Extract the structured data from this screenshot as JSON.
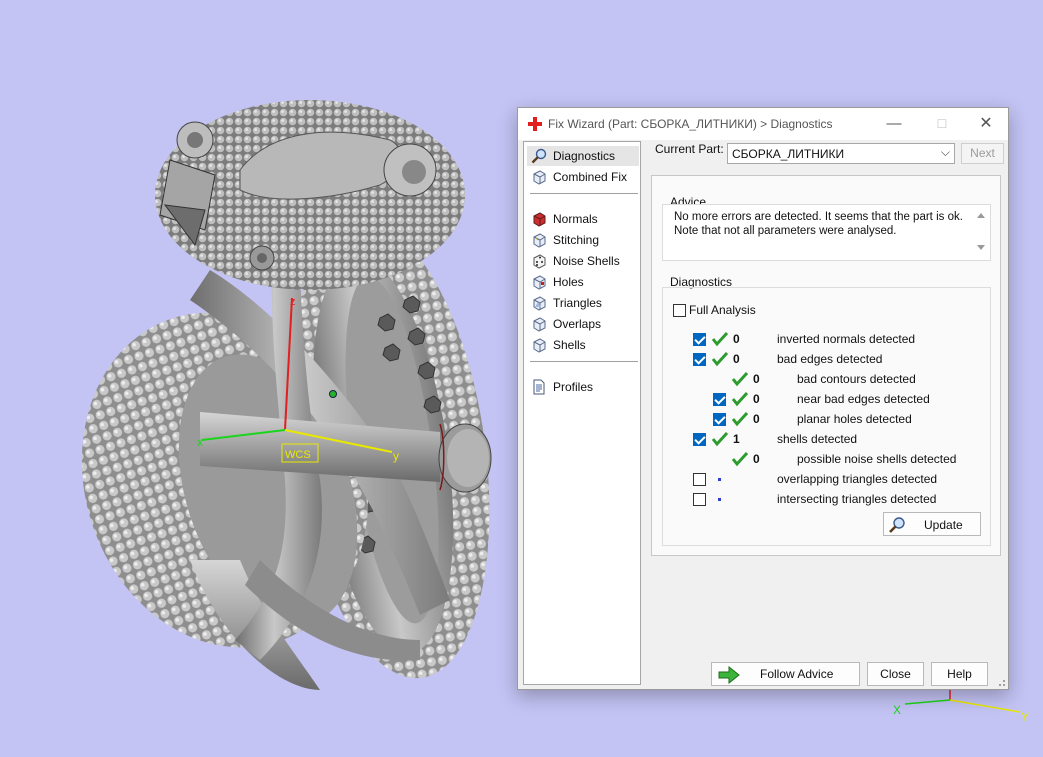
{
  "viewport": {
    "background_color": "#c3c3f4",
    "axis_labels": {
      "z": "z",
      "x": "x",
      "y": "y"
    },
    "wcs_label": "WCS",
    "mini_axes": {
      "x": "X",
      "y": "Y"
    }
  },
  "dialog": {
    "title": "Fix Wizard (Part: СБОРКА_ЛИТНИКИ) > Diagnostics",
    "title_icon": "red-cross-icon",
    "controls": {
      "minimize": "—",
      "maximize": "☐",
      "close": "✕"
    }
  },
  "nav": {
    "items": [
      {
        "label": "Diagnostics",
        "icon": "magnifier-icon",
        "selected": true
      },
      {
        "label": "Combined Fix",
        "icon": "cube-icon"
      },
      {
        "label": "Normals",
        "icon": "red-cube-icon"
      },
      {
        "label": "Stitching",
        "icon": "cube-icon"
      },
      {
        "label": "Noise Shells",
        "icon": "dice-icon"
      },
      {
        "label": "Holes",
        "icon": "cube-icon"
      },
      {
        "label": "Triangles",
        "icon": "cube-icon"
      },
      {
        "label": "Overlaps",
        "icon": "cube-icon"
      },
      {
        "label": "Shells",
        "icon": "cube-icon"
      },
      {
        "label": "Profiles",
        "icon": "document-icon"
      }
    ]
  },
  "current_part": {
    "label": "Current Part:",
    "value": "СБОРКА_ЛИТНИКИ",
    "next_label": "Next"
  },
  "advice": {
    "title": "Advice",
    "line1": "No more errors are detected. It seems that the part is ok.",
    "line2": "Note that not all parameters were analysed."
  },
  "diagnostics": {
    "title": "Diagnostics",
    "full_analysis_label": "Full Analysis",
    "full_analysis_checked": false,
    "rows": [
      {
        "checkbox": true,
        "checked": true,
        "status": "ok",
        "count": "0",
        "label": "inverted normals detected",
        "indent": 0
      },
      {
        "checkbox": true,
        "checked": true,
        "status": "ok",
        "count": "0",
        "label": "bad edges detected",
        "indent": 0
      },
      {
        "checkbox": false,
        "status": "ok",
        "count": "0",
        "label": "bad contours detected",
        "indent": 1
      },
      {
        "checkbox": true,
        "checked": true,
        "status": "ok",
        "count": "0",
        "label": "near bad edges detected",
        "indent": 1
      },
      {
        "checkbox": true,
        "checked": true,
        "status": "ok",
        "count": "0",
        "label": "planar holes detected",
        "indent": 1
      },
      {
        "checkbox": true,
        "checked": true,
        "status": "ok",
        "count": "1",
        "label": "shells detected",
        "indent": 0
      },
      {
        "checkbox": false,
        "status": "ok",
        "count": "0",
        "label": "possible noise shells detected",
        "indent": 1
      },
      {
        "checkbox": true,
        "checked": false,
        "status": "not-analysed",
        "count": "",
        "label": "overlapping triangles detected",
        "indent": 0
      },
      {
        "checkbox": true,
        "checked": false,
        "status": "not-analysed",
        "count": "",
        "label": "intersecting triangles detected",
        "indent": 0
      }
    ],
    "update_label": "Update"
  },
  "buttons": {
    "follow_advice": "Follow Advice",
    "close": "Close",
    "help": "Help"
  },
  "colors": {
    "accent": "#0067c0",
    "ok_green": "#2e9b2e",
    "dot_blue": "#2b3fd6",
    "axis_x": "#1bd41b",
    "axis_y": "#e8e800",
    "axis_z": "#e02020"
  }
}
